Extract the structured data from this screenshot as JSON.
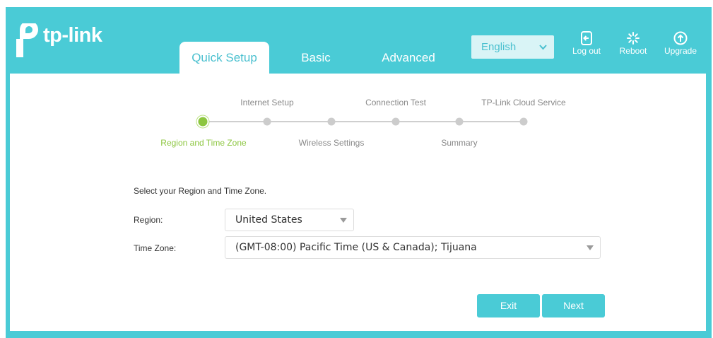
{
  "header": {
    "logo_text": "tp-link",
    "tabs": [
      {
        "label": "Quick Setup",
        "active": true
      },
      {
        "label": "Basic",
        "active": false
      },
      {
        "label": "Advanced",
        "active": false
      }
    ],
    "language": "English",
    "actions": [
      {
        "label": "Log out",
        "icon": "logout-icon"
      },
      {
        "label": "Reboot",
        "icon": "reboot-icon"
      },
      {
        "label": "Upgrade",
        "icon": "upgrade-icon"
      }
    ]
  },
  "wizard": {
    "steps": [
      {
        "label": "Region and Time Zone",
        "active": true
      },
      {
        "label": "Internet Setup",
        "active": false
      },
      {
        "label": "Wireless Settings",
        "active": false
      },
      {
        "label": "Connection Test",
        "active": false
      },
      {
        "label": "Summary",
        "active": false
      },
      {
        "label": "TP-Link Cloud Service",
        "active": false
      }
    ]
  },
  "form": {
    "instruction": "Select your Region and Time Zone.",
    "region_label": "Region:",
    "region_value": "United States",
    "timezone_label": "Time Zone:",
    "timezone_value": "(GMT-08:00) Pacific Time (US & Canada); Tijuana"
  },
  "buttons": {
    "exit": "Exit",
    "next": "Next"
  },
  "colors": {
    "brand": "#4acbd6",
    "active_step": "#8cc63f",
    "active_tab_text": "#4ac0cf"
  }
}
